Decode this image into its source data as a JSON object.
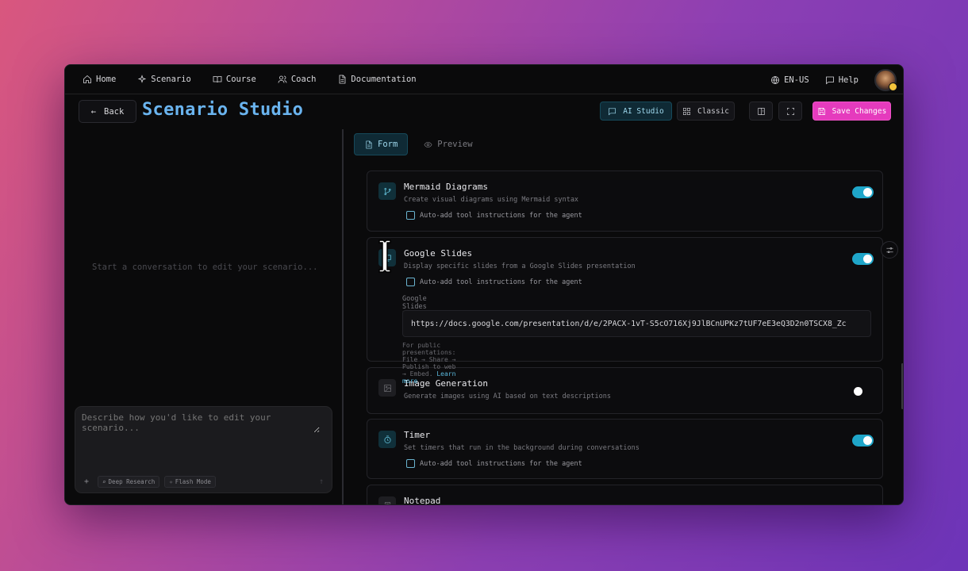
{
  "nav": {
    "items": [
      {
        "label": "Home",
        "icon": "home-icon"
      },
      {
        "label": "Scenario",
        "icon": "sparkles-icon"
      },
      {
        "label": "Course",
        "icon": "book-open-icon"
      },
      {
        "label": "Coach",
        "icon": "users-icon"
      },
      {
        "label": "Documentation",
        "icon": "file-text-icon"
      }
    ],
    "language": "EN-US",
    "help": "Help"
  },
  "header": {
    "back_label": "Back",
    "title": "Scenario Studio",
    "ai_studio_label": "AI Studio",
    "classic_label": "Classic",
    "save_label": "Save Changes"
  },
  "left": {
    "empty_message": "Start a conversation to edit your scenario...",
    "chat_placeholder": "Describe how you'd like to edit your scenario...",
    "add_symbol": "+",
    "deep_research": "Deep Research",
    "flash_mode": "Flash Mode",
    "send_symbol": "↑"
  },
  "tabs": {
    "form": "Form",
    "preview": "Preview"
  },
  "cards": {
    "mermaid": {
      "title": "Mermaid Diagrams",
      "desc": "Create visual diagrams using Mermaid syntax",
      "auto_add": "Auto-add tool instructions for the agent",
      "enabled": true
    },
    "slides": {
      "title": "Google Slides",
      "desc": "Display specific slides from a Google Slides presentation",
      "auto_add": "Auto-add tool instructions for the agent",
      "url_label": "Google Slides URL",
      "url_value": "https://docs.google.com/presentation/d/e/2PACX-1vT-S5cO716Xj9JlBCnUPKz7tUF7eE3eQ3D2n0TSCX8_Zc",
      "hint": "For public presentations: File → Share → Publish to web → Embed.",
      "learn_more": "Learn more",
      "enabled": true
    },
    "image": {
      "title": "Image Generation",
      "desc": "Generate images using AI based on text descriptions",
      "enabled": false
    },
    "timer": {
      "title": "Timer",
      "desc": "Set timers that run in the background during conversations",
      "auto_add": "Auto-add tool instructions for the agent",
      "enabled": true
    },
    "notepad": {
      "title": "Notepad"
    }
  },
  "colors": {
    "accent": "#1fa6c9",
    "title_blue": "#6ab4ef",
    "save_pink": "#e53bbd"
  }
}
